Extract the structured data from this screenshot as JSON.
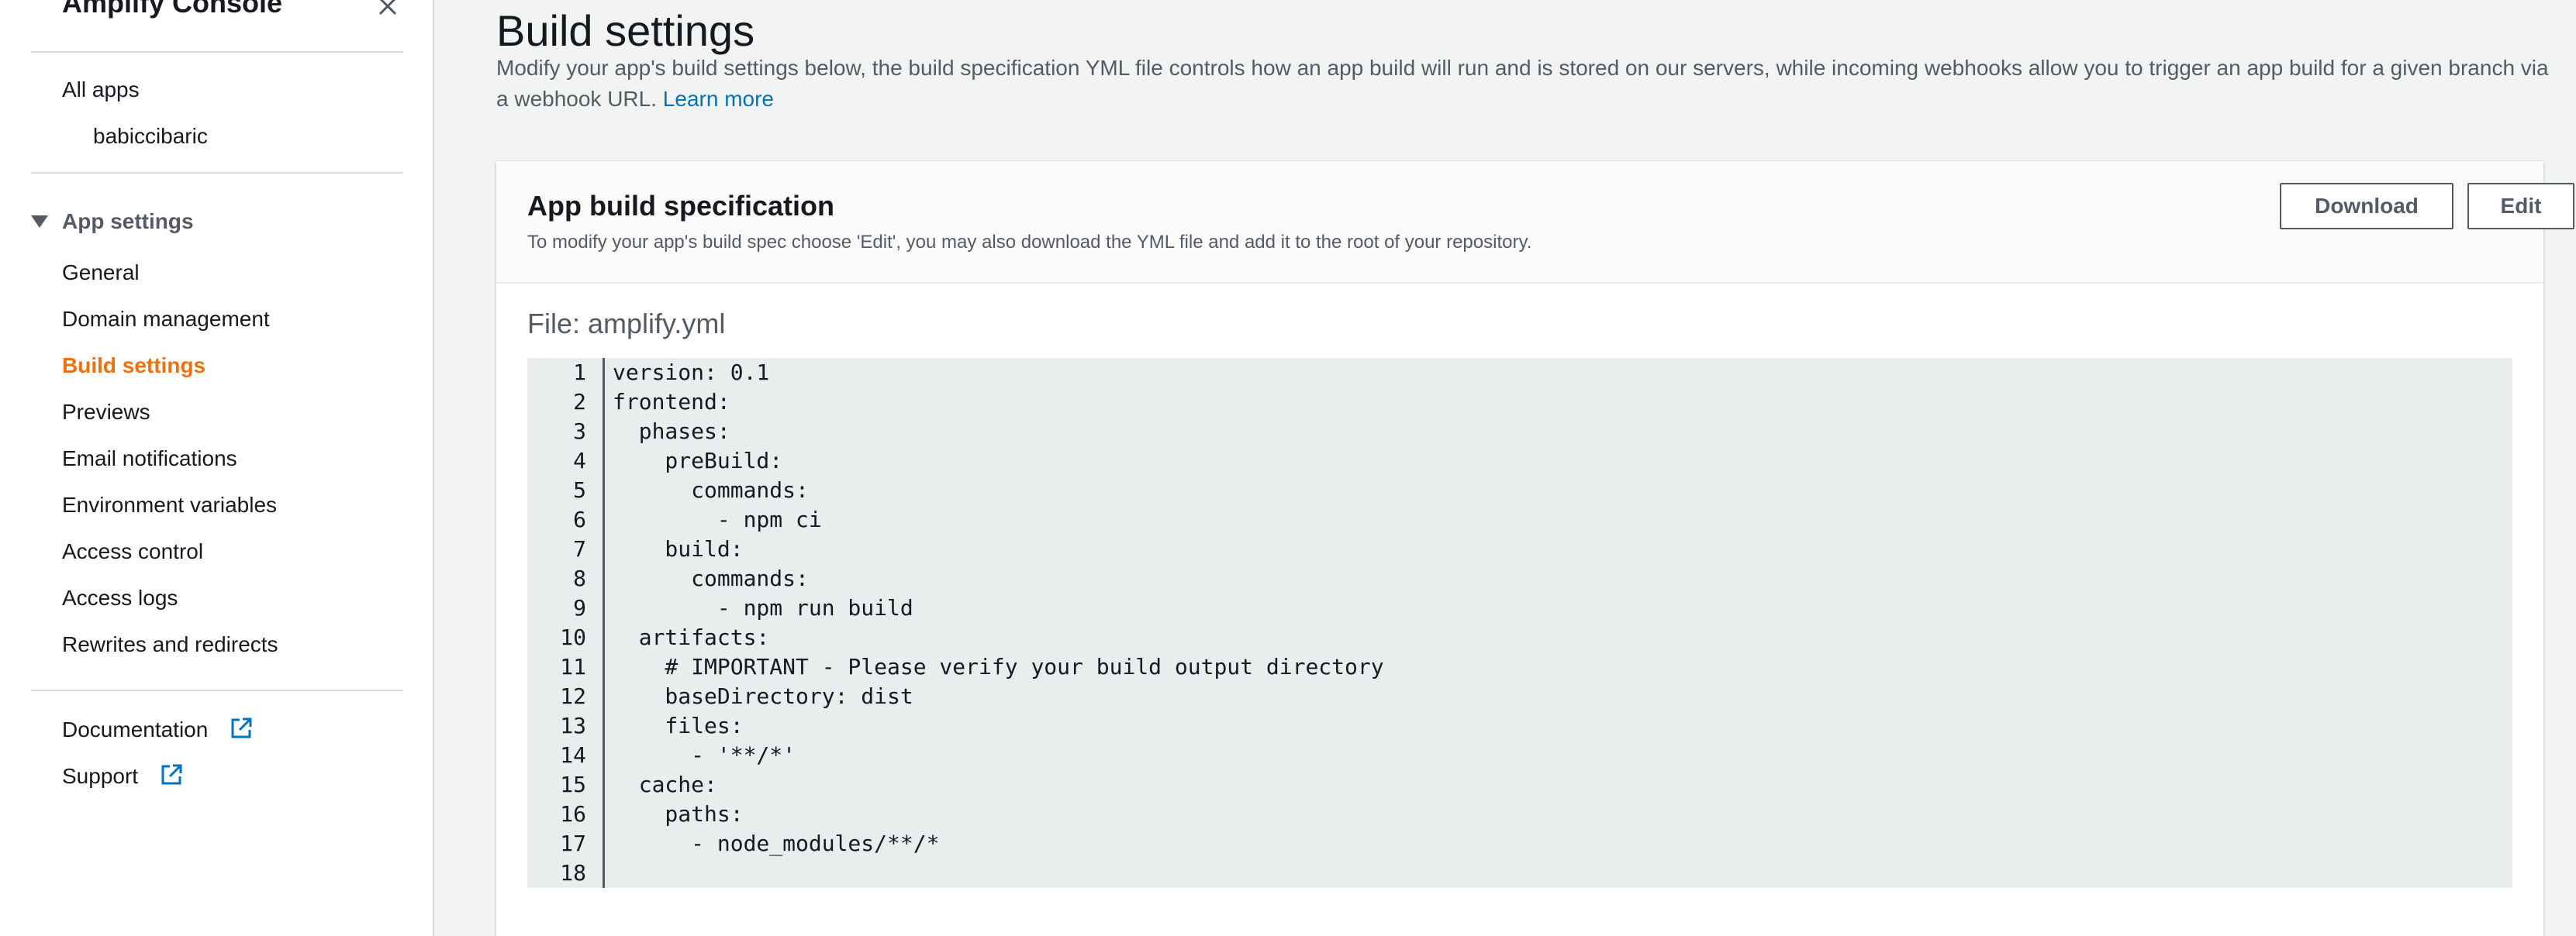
{
  "sidebar": {
    "title": "Amplify Console",
    "all_apps": "All apps",
    "app_name": "babiccibaric",
    "section_label": "App settings",
    "items": [
      {
        "label": "General"
      },
      {
        "label": "Domain management"
      },
      {
        "label": "Build settings",
        "active": true
      },
      {
        "label": "Previews"
      },
      {
        "label": "Email notifications"
      },
      {
        "label": "Environment variables"
      },
      {
        "label": "Access control"
      },
      {
        "label": "Access logs"
      },
      {
        "label": "Rewrites and redirects"
      }
    ],
    "documentation": "Documentation",
    "support": "Support"
  },
  "main": {
    "title": "Build settings",
    "description": "Modify your app's build settings below, the build specification YML file controls how an app build will run and is stored on our servers, while incoming webhooks allow you to trigger an app build for a given branch via a webhook URL.",
    "learn_more": "Learn more",
    "panel": {
      "title": "App build specification",
      "subtitle": "To modify your app's build spec choose 'Edit', you may also download the YML file and add it to the root of your repository.",
      "download_label": "Download",
      "edit_label": "Edit",
      "file_label": "File: amplify.yml",
      "code_lines": [
        "version: 0.1",
        "frontend:",
        "  phases:",
        "    preBuild:",
        "      commands:",
        "        - npm ci",
        "    build:",
        "      commands:",
        "        - npm run build",
        "  artifacts:",
        "    # IMPORTANT - Please verify your build output directory",
        "    baseDirectory: dist",
        "    files:",
        "      - '**/*'",
        "  cache:",
        "    paths:",
        "      - node_modules/**/*",
        ""
      ]
    }
  },
  "colors": {
    "accent_active": "#ec7211",
    "link": "#0073bb",
    "page_bg": "#f2f3f3",
    "code_bg": "#eaeded"
  },
  "icons": {
    "close": "close-icon",
    "caret": "caret-down-icon",
    "external": "external-link-icon"
  }
}
